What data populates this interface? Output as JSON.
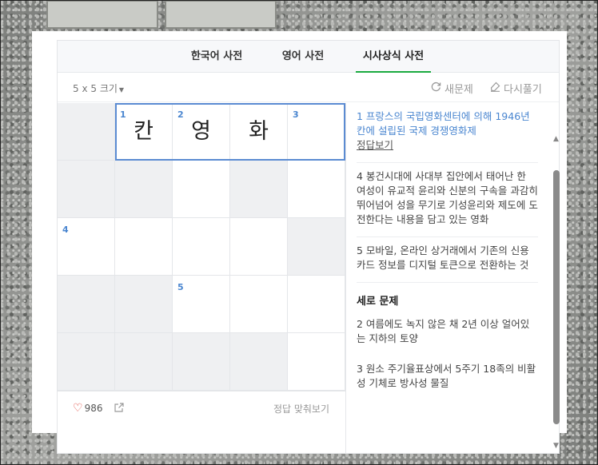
{
  "tabs": [
    {
      "label": "한국어 사전",
      "active": false
    },
    {
      "label": "영어 사전",
      "active": false
    },
    {
      "label": "시사상식 사전",
      "active": true
    }
  ],
  "toolbar": {
    "size_label": "5 x 5 크기",
    "new_puzzle_label": "새문제",
    "retry_label": "다시풀기"
  },
  "grid": {
    "rows": [
      [
        {
          "blocked": true,
          "num": "",
          "ch": ""
        },
        {
          "blocked": false,
          "num": "1",
          "ch": "칸"
        },
        {
          "blocked": false,
          "num": "2",
          "ch": "영"
        },
        {
          "blocked": false,
          "num": "",
          "ch": "화"
        },
        {
          "blocked": false,
          "num": "3",
          "ch": ""
        }
      ],
      [
        {
          "blocked": true,
          "num": "",
          "ch": ""
        },
        {
          "blocked": true,
          "num": "",
          "ch": ""
        },
        {
          "blocked": false,
          "num": "",
          "ch": ""
        },
        {
          "blocked": true,
          "num": "",
          "ch": ""
        },
        {
          "blocked": false,
          "num": "",
          "ch": ""
        }
      ],
      [
        {
          "blocked": false,
          "num": "4",
          "ch": ""
        },
        {
          "blocked": false,
          "num": "",
          "ch": ""
        },
        {
          "blocked": false,
          "num": "",
          "ch": ""
        },
        {
          "blocked": false,
          "num": "",
          "ch": ""
        },
        {
          "blocked": true,
          "num": "",
          "ch": ""
        }
      ],
      [
        {
          "blocked": true,
          "num": "",
          "ch": ""
        },
        {
          "blocked": true,
          "num": "",
          "ch": ""
        },
        {
          "blocked": false,
          "num": "5",
          "ch": ""
        },
        {
          "blocked": false,
          "num": "",
          "ch": ""
        },
        {
          "blocked": false,
          "num": "",
          "ch": ""
        }
      ],
      [
        {
          "blocked": true,
          "num": "",
          "ch": ""
        },
        {
          "blocked": true,
          "num": "",
          "ch": ""
        },
        {
          "blocked": true,
          "num": "",
          "ch": ""
        },
        {
          "blocked": true,
          "num": "",
          "ch": ""
        },
        {
          "blocked": false,
          "num": "",
          "ch": ""
        }
      ]
    ]
  },
  "footer": {
    "like_count": "986",
    "reveal_all_label": "정답 맞춰보기"
  },
  "clues": {
    "across": [
      {
        "text": "1 프랑스의 국립영화센터에 의해 1946년 칸에 설립된 국제 경쟁영화제",
        "answer_link": "정답보기",
        "active": true
      },
      {
        "text": "4 봉건시대에 사대부 집안에서 태어난 한 여성이 유교적 윤리와 신분의 구속을 과감히 뛰어넘어 성을 무기로 기성윤리와 제도에 도전한다는 내용을 담고 있는 영화"
      },
      {
        "text": "5 모바일, 온라인 상거래에서 기존의 신용카드 정보를 디지털 토큰으로 전환하는 것"
      }
    ],
    "down_header": "세로 문제",
    "down": [
      {
        "text": "2 여름에도 녹지 않은 채 2년 이상 얼어있는 지하의 토양"
      },
      {
        "text": "3 원소 주기율표상에서 5주기 18족의 비활성 기체로 방사성 물질"
      }
    ]
  },
  "colors": {
    "accent_blue": "#4a86d0",
    "active_tab_underline": "#1aaa3f",
    "heart": "#e0453c"
  }
}
